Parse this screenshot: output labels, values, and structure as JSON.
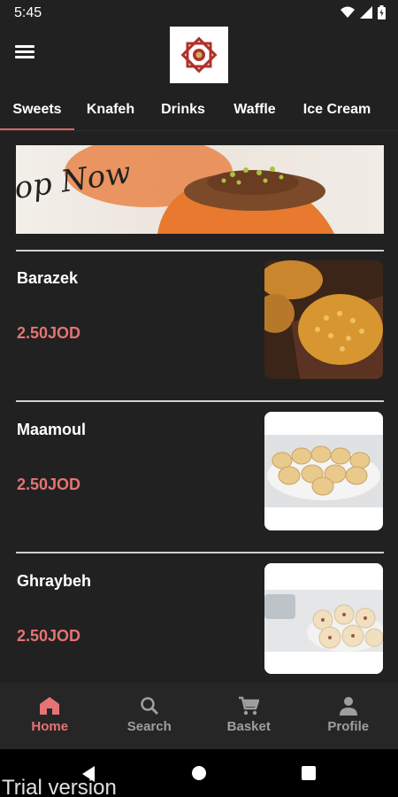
{
  "status_bar": {
    "time": "5:45"
  },
  "tabs": [
    {
      "label": "Sweets",
      "active": true
    },
    {
      "label": "Knafeh",
      "active": false
    },
    {
      "label": "Drinks",
      "active": false
    },
    {
      "label": "Waffle",
      "active": false
    },
    {
      "label": "Ice Cream",
      "active": false
    }
  ],
  "banner": {
    "text": "op Now"
  },
  "items": [
    {
      "name": "Barazek",
      "price": "2.50JOD"
    },
    {
      "name": "Maamoul",
      "price": "2.50JOD"
    },
    {
      "name": "Ghraybeh",
      "price": "2.50JOD"
    }
  ],
  "bottom_nav": [
    {
      "label": "Home",
      "icon": "home-icon",
      "active": true
    },
    {
      "label": "Search",
      "icon": "search-icon",
      "active": false
    },
    {
      "label": "Basket",
      "icon": "cart-icon",
      "active": false
    },
    {
      "label": "Profile",
      "icon": "person-icon",
      "active": false
    }
  ],
  "watermark": "Trial version",
  "colors": {
    "accent": "#e57373",
    "background": "#212121",
    "nav_background": "#262626"
  }
}
